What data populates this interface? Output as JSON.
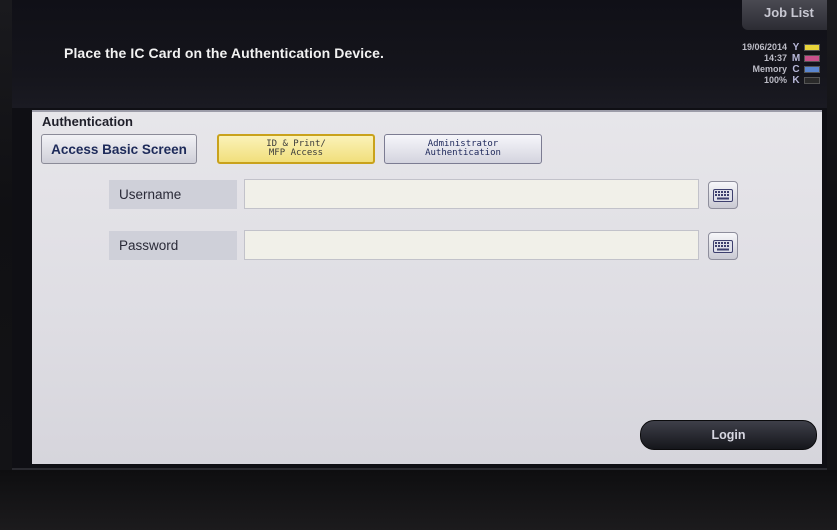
{
  "header": {
    "message": "Place the IC Card on the Authentication Device.",
    "job_list_label": "Job List",
    "date": "19/06/2014",
    "time": "14:37",
    "memory_label": "Memory",
    "memory_value": "100%",
    "toner": [
      {
        "channel": "Y",
        "color": "#e8d43a"
      },
      {
        "channel": "M",
        "color": "#c8508a"
      },
      {
        "channel": "C",
        "color": "#5a86d0"
      },
      {
        "channel": "K",
        "color": "#2a2a2a"
      }
    ]
  },
  "panel": {
    "title": "Authentication",
    "tabs": [
      {
        "label": "Access Basic Screen"
      },
      {
        "label": "ID & Print/\nMFP Access"
      },
      {
        "label": "Administrator\nAuthentication"
      }
    ],
    "username_label": "Username",
    "username_value": "",
    "password_label": "Password",
    "password_value": "",
    "keyboard_icon": "keyboard-icon",
    "login_label": "Login"
  }
}
